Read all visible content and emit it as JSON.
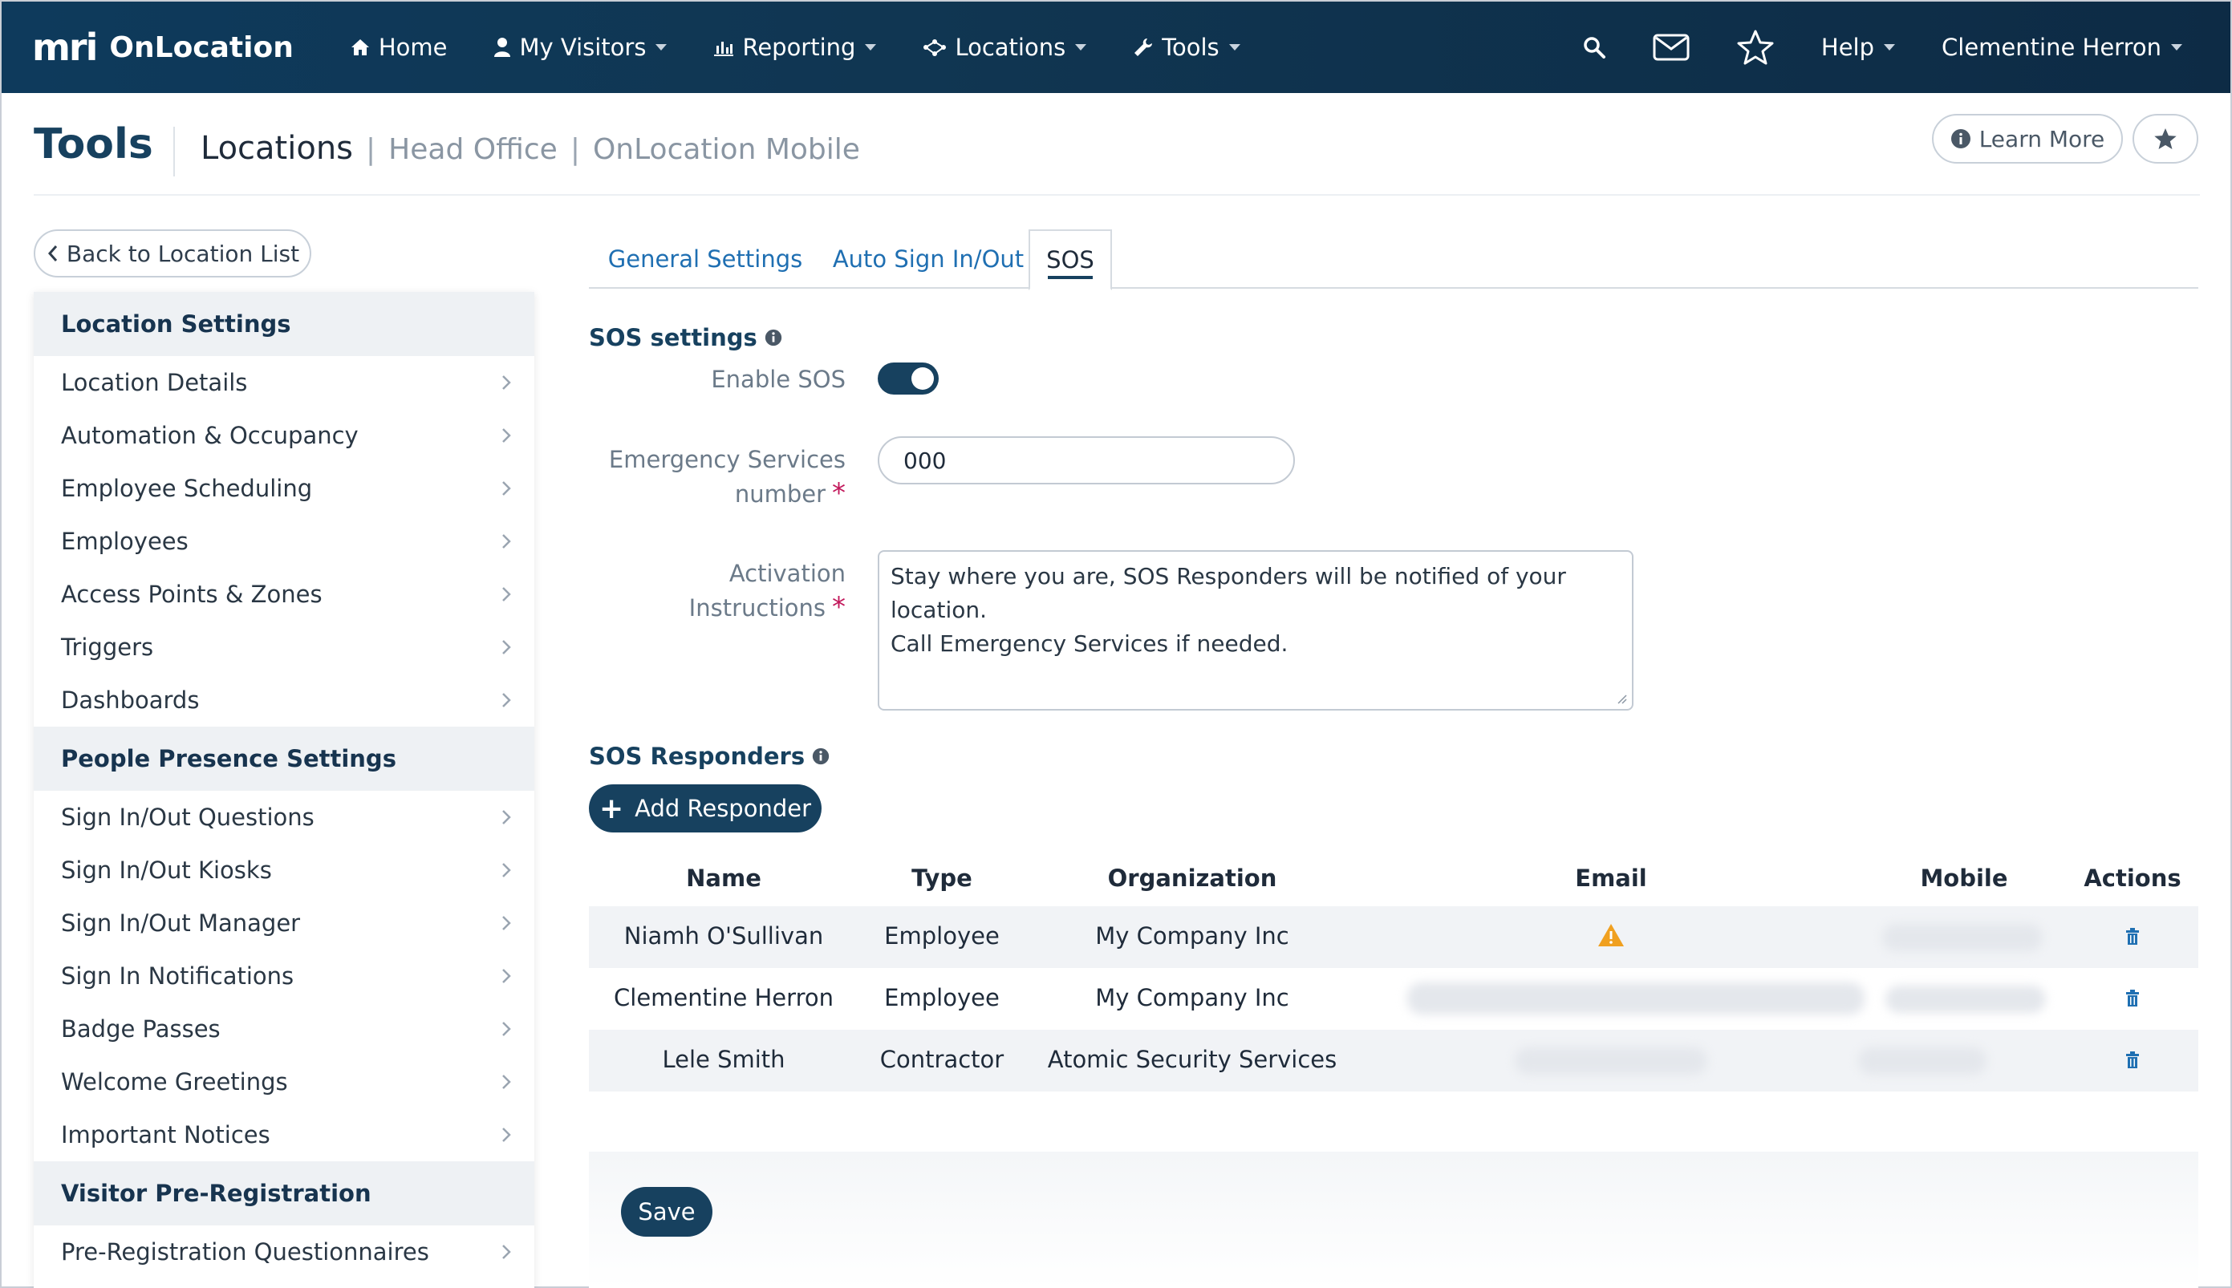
{
  "nav": {
    "brand_mark": "mri",
    "brand_name": "OnLocation",
    "items": [
      {
        "label": "Home",
        "icon": "home-icon"
      },
      {
        "label": "My Visitors",
        "icon": "user-icon"
      },
      {
        "label": "Reporting",
        "icon": "bar-chart-icon"
      },
      {
        "label": "Locations",
        "icon": "network-icon"
      },
      {
        "label": "Tools",
        "icon": "wrench-icon"
      }
    ],
    "help_label": "Help",
    "user_name": "Clementine Herron"
  },
  "header": {
    "title": "Tools",
    "crumb_main": "Locations",
    "crumb_location": "Head Office",
    "crumb_site": "OnLocation Mobile",
    "learn_more": "Learn More"
  },
  "sidebar": {
    "back_label": "Back to Location List",
    "sections": [
      {
        "title": "Location Settings",
        "items": [
          "Location Details",
          "Automation & Occupancy",
          "Employee Scheduling",
          "Employees",
          "Access Points & Zones",
          "Triggers",
          "Dashboards"
        ]
      },
      {
        "title": "People Presence Settings",
        "items": [
          "Sign In/Out Questions",
          "Sign In/Out Kiosks",
          "Sign In/Out Manager",
          "Sign In Notifications",
          "Badge Passes",
          "Welcome Greetings",
          "Important Notices"
        ]
      },
      {
        "title": "Visitor Pre-Registration",
        "items": [
          "Pre-Registration Questionnaires"
        ]
      }
    ]
  },
  "tabs": [
    "General Settings",
    "Auto Sign In/Out",
    "SOS"
  ],
  "sos": {
    "heading": "SOS settings",
    "enable_label": "Enable SOS",
    "enabled": true,
    "emergency_label_1": "Emergency Services",
    "emergency_label_2": "number",
    "emergency_value": "000",
    "activation_label_1": "Activation",
    "activation_label_2": "Instructions",
    "activation_line_1": "Stay where you are, SOS Responders will be notified of your location.",
    "activation_line_2": "Call Emergency Services if needed.",
    "required_mark": "*"
  },
  "responders": {
    "heading": "SOS Responders",
    "add_label": "Add Responder",
    "columns": [
      "Name",
      "Type",
      "Organization",
      "Email",
      "Mobile",
      "Actions"
    ],
    "rows": [
      {
        "name": "Niamh O'Sullivan",
        "type": "Employee",
        "organization": "My Company Inc",
        "email_warning": true
      },
      {
        "name": "Clementine Herron",
        "type": "Employee",
        "organization": "My Company Inc",
        "email_warning": false
      },
      {
        "name": "Lele Smith",
        "type": "Contractor",
        "organization": "Atomic Security Services",
        "email_warning": false
      }
    ]
  },
  "save_label": "Save",
  "colors": {
    "primary": "#17415f",
    "link": "#1f6fb2",
    "warning": "#f0a020",
    "required": "#c2185b"
  }
}
